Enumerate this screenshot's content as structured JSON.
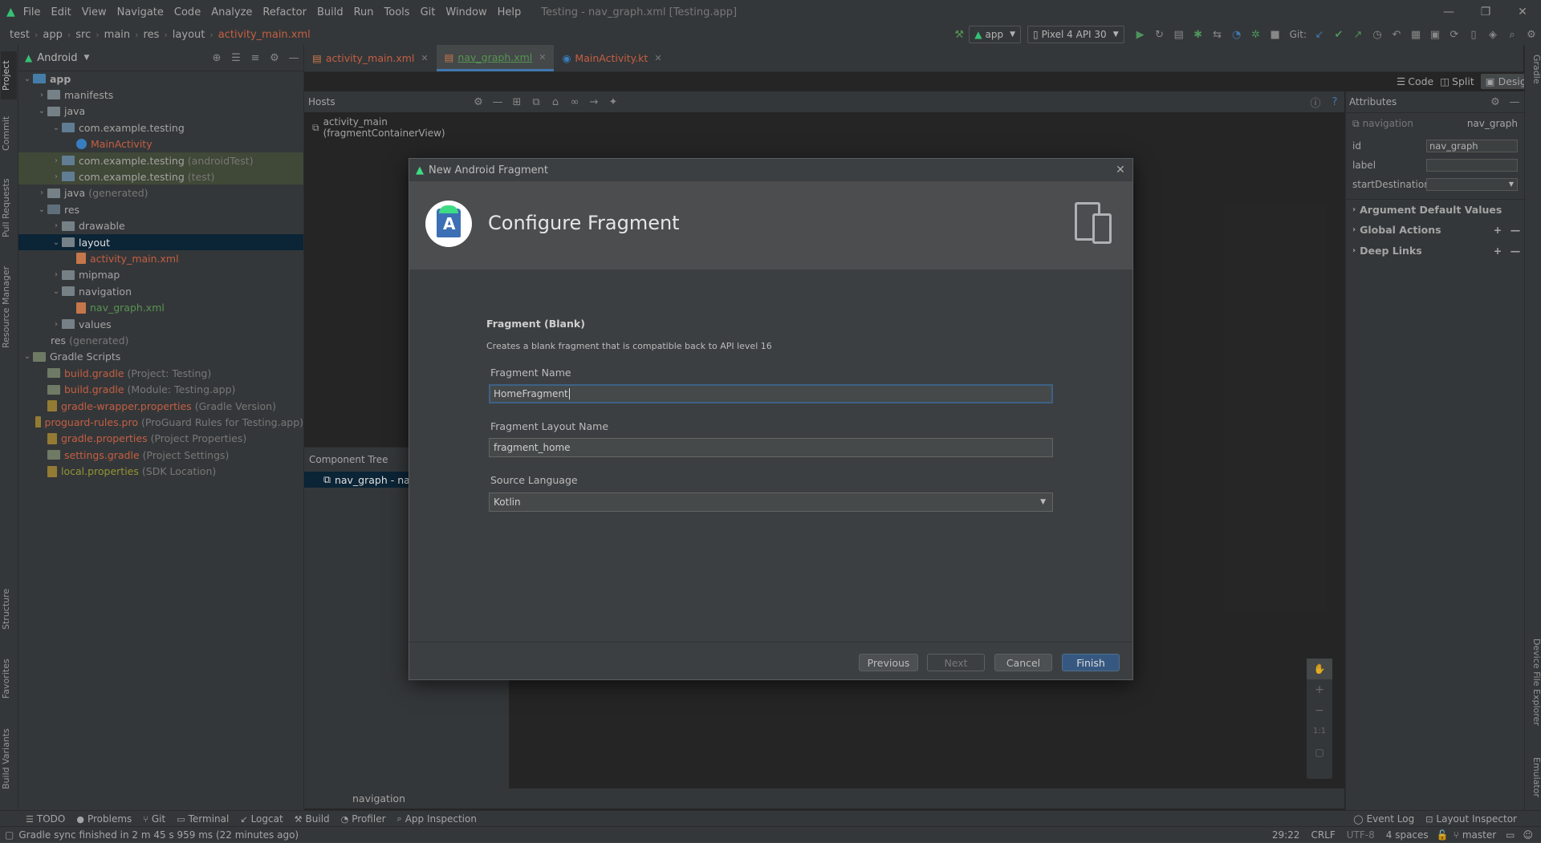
{
  "menu": {
    "items": [
      "File",
      "Edit",
      "View",
      "Navigate",
      "Code",
      "Analyze",
      "Refactor",
      "Build",
      "Run",
      "Tools",
      "Git",
      "Window",
      "Help"
    ],
    "window_title": "Testing - nav_graph.xml [Testing.app]"
  },
  "breadcrumb": [
    "test",
    "app",
    "src",
    "main",
    "res",
    "layout",
    "activity_main.xml"
  ],
  "toolbar": {
    "run_config": "app",
    "device": "Pixel 4 API 30",
    "git_label": "Git:"
  },
  "left_stripe": [
    "Project",
    "Commit",
    "Pull Requests",
    "Resource Manager",
    "Structure",
    "Favorites",
    "Build Variants"
  ],
  "right_stripe": [
    "Gradle",
    "Device File Explorer",
    "Emulator"
  ],
  "project": {
    "view": "Android",
    "tree": [
      {
        "label": "app",
        "hint": "",
        "level": 0,
        "arrow": "down",
        "icon": "appf",
        "color": "#bbbbbb",
        "bold": true
      },
      {
        "label": "manifests",
        "hint": "",
        "level": 1,
        "arrow": "right",
        "icon": "folder",
        "color": "#bbbbbb"
      },
      {
        "label": "java",
        "hint": "",
        "level": 1,
        "arrow": "down",
        "icon": "folder",
        "color": "#bbbbbb"
      },
      {
        "label": "com.example.testing",
        "hint": "",
        "level": 2,
        "arrow": "down",
        "icon": "pkg",
        "color": "#bbbbbb"
      },
      {
        "label": "MainActivity",
        "hint": "",
        "level": 3,
        "arrow": "",
        "icon": "filek",
        "color": "#e06c4c"
      },
      {
        "label": "com.example.testing",
        "hint": "(androidTest)",
        "level": 2,
        "arrow": "right",
        "icon": "pkg",
        "color": "#bbbbbb",
        "bg": "#49533f"
      },
      {
        "label": "com.example.testing",
        "hint": "(test)",
        "level": 2,
        "arrow": "right",
        "icon": "pkg",
        "color": "#bbbbbb",
        "bg": "#49533f"
      },
      {
        "label": "java",
        "hint": "(generated)",
        "level": 1,
        "arrow": "right",
        "icon": "folder",
        "color": "#bbbbbb"
      },
      {
        "label": "res",
        "hint": "",
        "level": 1,
        "arrow": "down",
        "icon": "resf",
        "color": "#bbbbbb"
      },
      {
        "label": "drawable",
        "hint": "",
        "level": 2,
        "arrow": "right",
        "icon": "folder",
        "color": "#bbbbbb"
      },
      {
        "label": "layout",
        "hint": "",
        "level": 2,
        "arrow": "down",
        "icon": "folder",
        "color": "#ffffff",
        "bg": "#0d293e"
      },
      {
        "label": "activity_main.xml",
        "hint": "",
        "level": 3,
        "arrow": "",
        "icon": "filex",
        "color": "#e06c4c"
      },
      {
        "label": "mipmap",
        "hint": "",
        "level": 2,
        "arrow": "right",
        "icon": "folder",
        "color": "#bbbbbb"
      },
      {
        "label": "navigation",
        "hint": "",
        "level": 2,
        "arrow": "down",
        "icon": "folder",
        "color": "#bbbbbb"
      },
      {
        "label": "nav_graph.xml",
        "hint": "",
        "level": 3,
        "arrow": "",
        "icon": "filex",
        "color": "#62a95d"
      },
      {
        "label": "values",
        "hint": "",
        "level": 2,
        "arrow": "right",
        "icon": "folder",
        "color": "#bbbbbb"
      },
      {
        "label": "res",
        "hint": "(generated)",
        "level": 1,
        "arrow": "",
        "icon": "",
        "color": "#bbbbbb"
      },
      {
        "label": "Gradle Scripts",
        "hint": "",
        "level": 0,
        "arrow": "down",
        "icon": "grad",
        "color": "#bbbbbb"
      },
      {
        "label": "build.gradle",
        "hint": "(Project: Testing)",
        "level": 1,
        "arrow": "",
        "icon": "grad",
        "color": "#e06c4c"
      },
      {
        "label": "build.gradle",
        "hint": "(Module: Testing.app)",
        "level": 1,
        "arrow": "",
        "icon": "grad",
        "color": "#e06c4c"
      },
      {
        "label": "gradle-wrapper.properties",
        "hint": "(Gradle Version)",
        "level": 1,
        "arrow": "",
        "icon": "prop",
        "color": "#e06c4c"
      },
      {
        "label": "proguard-rules.pro",
        "hint": "(ProGuard Rules for Testing.app)",
        "level": 1,
        "arrow": "",
        "icon": "prop",
        "color": "#e06c4c"
      },
      {
        "label": "gradle.properties",
        "hint": "(Project Properties)",
        "level": 1,
        "arrow": "",
        "icon": "prop",
        "color": "#e06c4c"
      },
      {
        "label": "settings.gradle",
        "hint": "(Project Settings)",
        "level": 1,
        "arrow": "",
        "icon": "grad",
        "color": "#e06c4c"
      },
      {
        "label": "local.properties",
        "hint": "(SDK Location)",
        "level": 1,
        "arrow": "",
        "icon": "prop",
        "color": "#a8a83c"
      }
    ]
  },
  "editor_tabs": [
    {
      "label": "activity_main.xml",
      "color": "#e06c4c",
      "active": false
    },
    {
      "label": "nav_graph.xml",
      "color": "#62a95d",
      "active": true
    },
    {
      "label": "MainActivity.kt",
      "color": "#e06c4c",
      "active": false
    }
  ],
  "view_modes": {
    "code": "Code",
    "split": "Split",
    "design": "Design"
  },
  "hosts": {
    "title": "Hosts",
    "item": "activity_main (fragmentContainerView)"
  },
  "component_tree": {
    "title": "Component Tree",
    "item": "nav_graph - nav"
  },
  "nav_bottom": "navigation",
  "attributes": {
    "title": "Attributes",
    "element_type": "navigation",
    "element_id": "nav_graph",
    "fields": [
      {
        "label": "id",
        "value": "nav_graph"
      },
      {
        "label": "label",
        "value": ""
      },
      {
        "label": "startDestination",
        "value": ""
      }
    ],
    "sections": [
      "Argument Default Values",
      "Global Actions",
      "Deep Links"
    ]
  },
  "bottom_tools": [
    "TODO",
    "Problems",
    "Git",
    "Terminal",
    "Logcat",
    "Build",
    "Profiler",
    "App Inspection"
  ],
  "bottom_tools_right": [
    "Event Log",
    "Layout Inspector"
  ],
  "status": {
    "message": "Gradle sync finished in 2 m 45 s 959 ms (22 minutes ago)",
    "position": "29:22",
    "line_sep": "CRLF",
    "encoding": "UTF-8",
    "indent": "4 spaces",
    "branch": "master"
  },
  "dialog": {
    "window_title": "New Android Fragment",
    "heading": "Configure Fragment",
    "template_name": "Fragment (Blank)",
    "template_desc": "Creates a blank fragment that is compatible back to API level 16",
    "fragment_name_label": "Fragment Name",
    "fragment_name_value": "HomeFragment",
    "layout_name_label": "Fragment Layout Name",
    "layout_name_value": "fragment_home",
    "language_label": "Source Language",
    "language_value": "Kotlin",
    "buttons": {
      "previous": "Previous",
      "next": "Next",
      "cancel": "Cancel",
      "finish": "Finish"
    }
  },
  "colors": {
    "accent": "#4a88c7",
    "finish_button": "#365880",
    "android_green": "#3ddc84"
  }
}
